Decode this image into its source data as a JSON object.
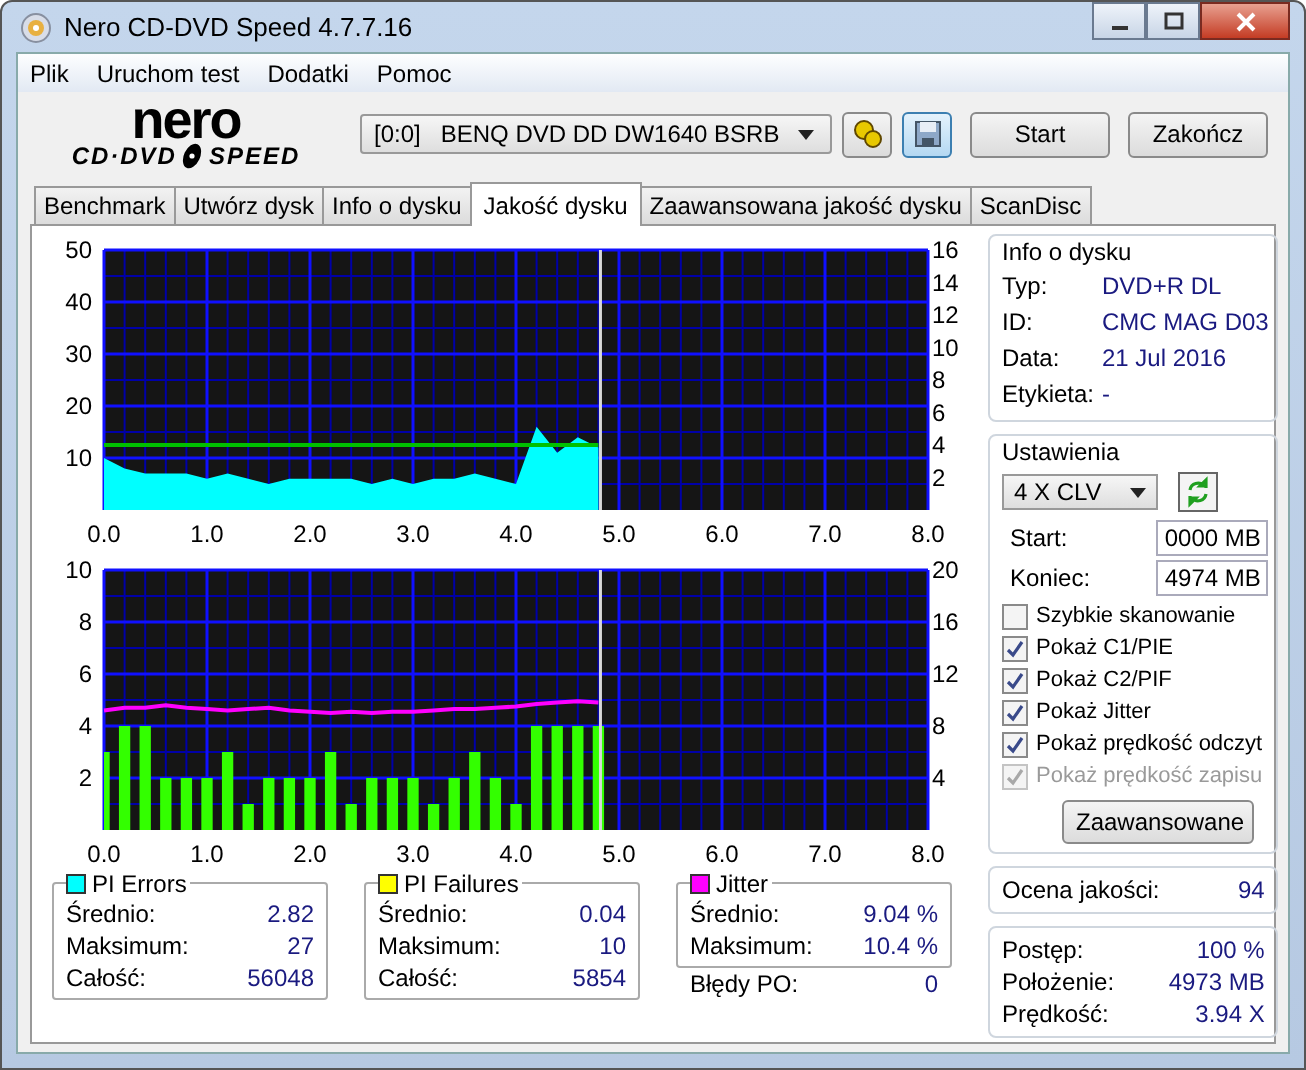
{
  "window": {
    "title": "Nero CD-DVD Speed 4.7.7.16"
  },
  "menu": [
    "Plik",
    "Uruchom test",
    "Dodatki",
    "Pomoc"
  ],
  "logo": {
    "top": "nero",
    "left": "CD·DVD",
    "right": "SPEED"
  },
  "toolbar": {
    "drive_id": "[0:0]",
    "drive_name": "BENQ DVD DD DW1640 BSRB",
    "buttons": [
      "Start",
      "Zakończ"
    ]
  },
  "tabs": [
    {
      "label": "Benchmark",
      "selected": false
    },
    {
      "label": "Utwórz dysk",
      "selected": false
    },
    {
      "label": "Info o dysku",
      "selected": false
    },
    {
      "label": "Jakość dysku",
      "selected": true
    },
    {
      "label": "Zaawansowana jakość dysku",
      "selected": false
    },
    {
      "label": "ScanDisc",
      "selected": false
    }
  ],
  "charts": [
    {
      "chart_data": {
        "type": "area",
        "xlim": [
          0,
          8
        ],
        "ylim": [
          0,
          50
        ],
        "y2lim": [
          0,
          16
        ],
        "xticks": [
          {
            "value": 0,
            "label": "0.0"
          },
          {
            "value": 1,
            "label": "1.0"
          },
          {
            "value": 2,
            "label": "2.0"
          },
          {
            "value": 3,
            "label": "3.0"
          },
          {
            "value": 4,
            "label": "4.0"
          },
          {
            "value": 5,
            "label": "5.0"
          },
          {
            "value": 6,
            "label": "6.0"
          },
          {
            "value": 7,
            "label": "7.0"
          },
          {
            "value": 8,
            "label": "8.0"
          }
        ],
        "yticks": [
          10,
          20,
          30,
          40,
          50
        ],
        "y2ticks": [
          2,
          4,
          6,
          8,
          10,
          12,
          14,
          16
        ],
        "x": [
          0,
          0.2,
          0.4,
          0.6,
          0.8,
          1,
          1.2,
          1.4,
          1.6,
          1.8,
          2,
          2.2,
          2.4,
          2.6,
          2.8,
          3,
          3.2,
          3.4,
          3.6,
          3.8,
          4,
          4.2,
          4.4,
          4.6,
          4.8
        ],
        "series": [
          {
            "color": "#00ffff",
            "values": [
              10,
              8,
              7,
              7,
              7,
              6,
              7,
              6,
              5,
              6,
              6,
              6,
              6,
              5,
              6,
              5,
              6,
              6,
              7,
              6,
              5,
              16,
              11,
              14,
              12
            ]
          },
          {
            "type": "line",
            "axis": "y2",
            "color": "#00c000",
            "values": [
              4,
              4,
              4,
              4,
              4,
              4,
              4,
              4,
              4,
              4,
              4,
              4,
              4,
              4,
              4,
              4,
              4,
              4,
              4,
              4,
              4,
              4,
              4,
              4,
              4
            ]
          }
        ],
        "grid": true,
        "ref_lines": [
          {
            "axis": "x",
            "value": 4.82
          }
        ]
      }
    },
    {
      "chart_data": {
        "type": "bar",
        "xlim": [
          0,
          8
        ],
        "ylim": [
          0,
          10
        ],
        "y2lim": [
          0,
          20
        ],
        "xticks": [
          {
            "value": 0,
            "label": "0.0"
          },
          {
            "value": 1,
            "label": "1.0"
          },
          {
            "value": 2,
            "label": "2.0"
          },
          {
            "value": 3,
            "label": "3.0"
          },
          {
            "value": 4,
            "label": "4.0"
          },
          {
            "value": 5,
            "label": "5.0"
          },
          {
            "value": 6,
            "label": "6.0"
          },
          {
            "value": 7,
            "label": "7.0"
          },
          {
            "value": 8,
            "label": "8.0"
          }
        ],
        "yticks": [
          2,
          4,
          6,
          8,
          10
        ],
        "y2ticks": [
          4,
          8,
          12,
          16,
          20
        ],
        "x": [
          0,
          0.2,
          0.4,
          0.6,
          0.8,
          1,
          1.2,
          1.4,
          1.6,
          1.8,
          2,
          2.2,
          2.4,
          2.6,
          2.8,
          3,
          3.2,
          3.4,
          3.6,
          3.8,
          4,
          4.2,
          4.4,
          4.6,
          4.8
        ],
        "series": [
          {
            "color": "#33ff00",
            "values": [
              3,
              4,
              4,
              2,
              2,
              2,
              3,
              1,
              2,
              2,
              2,
              3,
              1,
              2,
              2,
              2,
              1,
              2,
              3,
              2,
              1,
              4,
              4,
              4,
              4
            ]
          },
          {
            "type": "line",
            "axis": "y2",
            "color": "#ff00ff",
            "values": [
              9.2,
              9.4,
              9.4,
              9.6,
              9.4,
              9.3,
              9.2,
              9.3,
              9.4,
              9.2,
              9.1,
              9.0,
              9.1,
              9.0,
              9.1,
              9.1,
              9.2,
              9.3,
              9.3,
              9.4,
              9.5,
              9.7,
              9.8,
              9.9,
              9.8
            ]
          }
        ],
        "grid": true,
        "ref_lines": [
          {
            "axis": "x",
            "value": 4.82
          }
        ]
      }
    }
  ],
  "legend_boxes": [
    {
      "title": "PI Errors",
      "color": "#00ffff",
      "rows": [
        {
          "label": "Średnio:",
          "value": "2.82"
        },
        {
          "label": "Maksimum:",
          "value": "27"
        },
        {
          "label": "Całość:",
          "value": "56048"
        }
      ]
    },
    {
      "title": "PI Failures",
      "color": "#ffff00",
      "rows": [
        {
          "label": "Średnio:",
          "value": "0.04"
        },
        {
          "label": "Maksimum:",
          "value": "10"
        },
        {
          "label": "Całość:",
          "value": "5854"
        }
      ]
    },
    {
      "title": "Jitter",
      "color": "#ff00ff",
      "rows": [
        {
          "label": "Średnio:",
          "value": "9.04 %"
        },
        {
          "label": "Maksimum:",
          "value": "10.4 %"
        }
      ]
    }
  ],
  "po_errors": {
    "label": "Błędy PO:",
    "value": "0"
  },
  "disc_info": {
    "title": "Info o dysku",
    "rows": [
      {
        "label": "Typ:",
        "value": "DVD+R DL"
      },
      {
        "label": "ID:",
        "value": "CMC MAG D03"
      },
      {
        "label": "Data:",
        "value": "21 Jul 2016"
      },
      {
        "label": "Etykieta:",
        "value": "-"
      }
    ]
  },
  "settings": {
    "title": "Ustawienia",
    "speed": "4 X CLV",
    "start_label": "Start:",
    "start": "0000 MB",
    "end_label": "Koniec:",
    "end": "4974 MB",
    "options": [
      {
        "label": "Szybkie skanowanie",
        "checked": false,
        "disabled": false
      },
      {
        "label": "Pokaż C1/PIE",
        "checked": true,
        "disabled": false
      },
      {
        "label": "Pokaż C2/PIF",
        "checked": true,
        "disabled": false
      },
      {
        "label": "Pokaż Jitter",
        "checked": true,
        "disabled": false
      },
      {
        "label": "Pokaż prędkość odczyt",
        "checked": true,
        "disabled": false
      },
      {
        "label": "Pokaż prędkość zapisu",
        "checked": true,
        "disabled": true
      }
    ],
    "button": "Zaawansowane"
  },
  "quality": {
    "label": "Ocena jakości:",
    "value": "94"
  },
  "progress": [
    {
      "label": "Postęp:",
      "value": "100 %"
    },
    {
      "label": "Położenie:",
      "value": "4973 MB"
    },
    {
      "label": "Prędkość:",
      "value": "3.94 X"
    }
  ]
}
